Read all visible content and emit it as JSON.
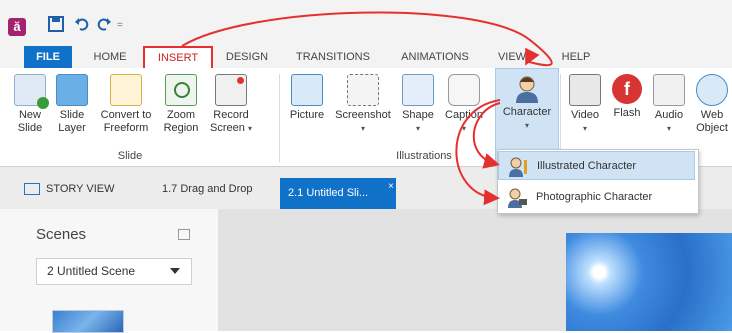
{
  "titlebar": {
    "app_icon": "ă",
    "save_icon": "save-icon",
    "undo_icon": "undo-icon",
    "redo_icon": "redo-icon",
    "customize_icon": "customize-qat-icon"
  },
  "tabs": [
    {
      "label": "FILE"
    },
    {
      "label": "HOME"
    },
    {
      "label": "INSERT"
    },
    {
      "label": "DESIGN"
    },
    {
      "label": "TRANSITIONS"
    },
    {
      "label": "ANIMATIONS"
    },
    {
      "label": "VIEW"
    },
    {
      "label": "HELP"
    }
  ],
  "ribbon": {
    "slide_group": {
      "label": "Slide",
      "buttons": [
        {
          "line1": "New",
          "line2": "Slide"
        },
        {
          "line1": "Slide",
          "line2": "Layer"
        },
        {
          "line1": "Convert to",
          "line2": "Freeform"
        },
        {
          "line1": "Zoom",
          "line2": "Region"
        },
        {
          "line1": "Record",
          "line2": "Screen"
        }
      ]
    },
    "illustrations_group": {
      "label": "Illustrations",
      "buttons": [
        {
          "line1": "Picture"
        },
        {
          "line1": "Screenshot"
        },
        {
          "line1": "Shape"
        },
        {
          "line1": "Caption"
        },
        {
          "line1": "Character"
        }
      ]
    },
    "media_group": {
      "buttons": [
        {
          "line1": "Video"
        },
        {
          "line1": "Flash"
        },
        {
          "line1": "Audio"
        },
        {
          "line1": "Web",
          "line2": "Object"
        }
      ]
    }
  },
  "character_menu": {
    "items": [
      {
        "label": "Illustrated Character",
        "icon": "illustrated-character-icon"
      },
      {
        "label": "Photographic Character",
        "icon": "photographic-character-icon"
      }
    ]
  },
  "doc_tabs": {
    "story_view": "STORY VIEW",
    "tab_2": "1.7 Drag and Drop",
    "active": "2.1 Untitled Sli...",
    "close": "×"
  },
  "scenes": {
    "title": "Scenes",
    "selected_scene": "2 Untitled Scene"
  },
  "colors": {
    "accent": "#0f72c8",
    "highlight": "#e53030",
    "menu_hover": "#cfe3f5"
  }
}
